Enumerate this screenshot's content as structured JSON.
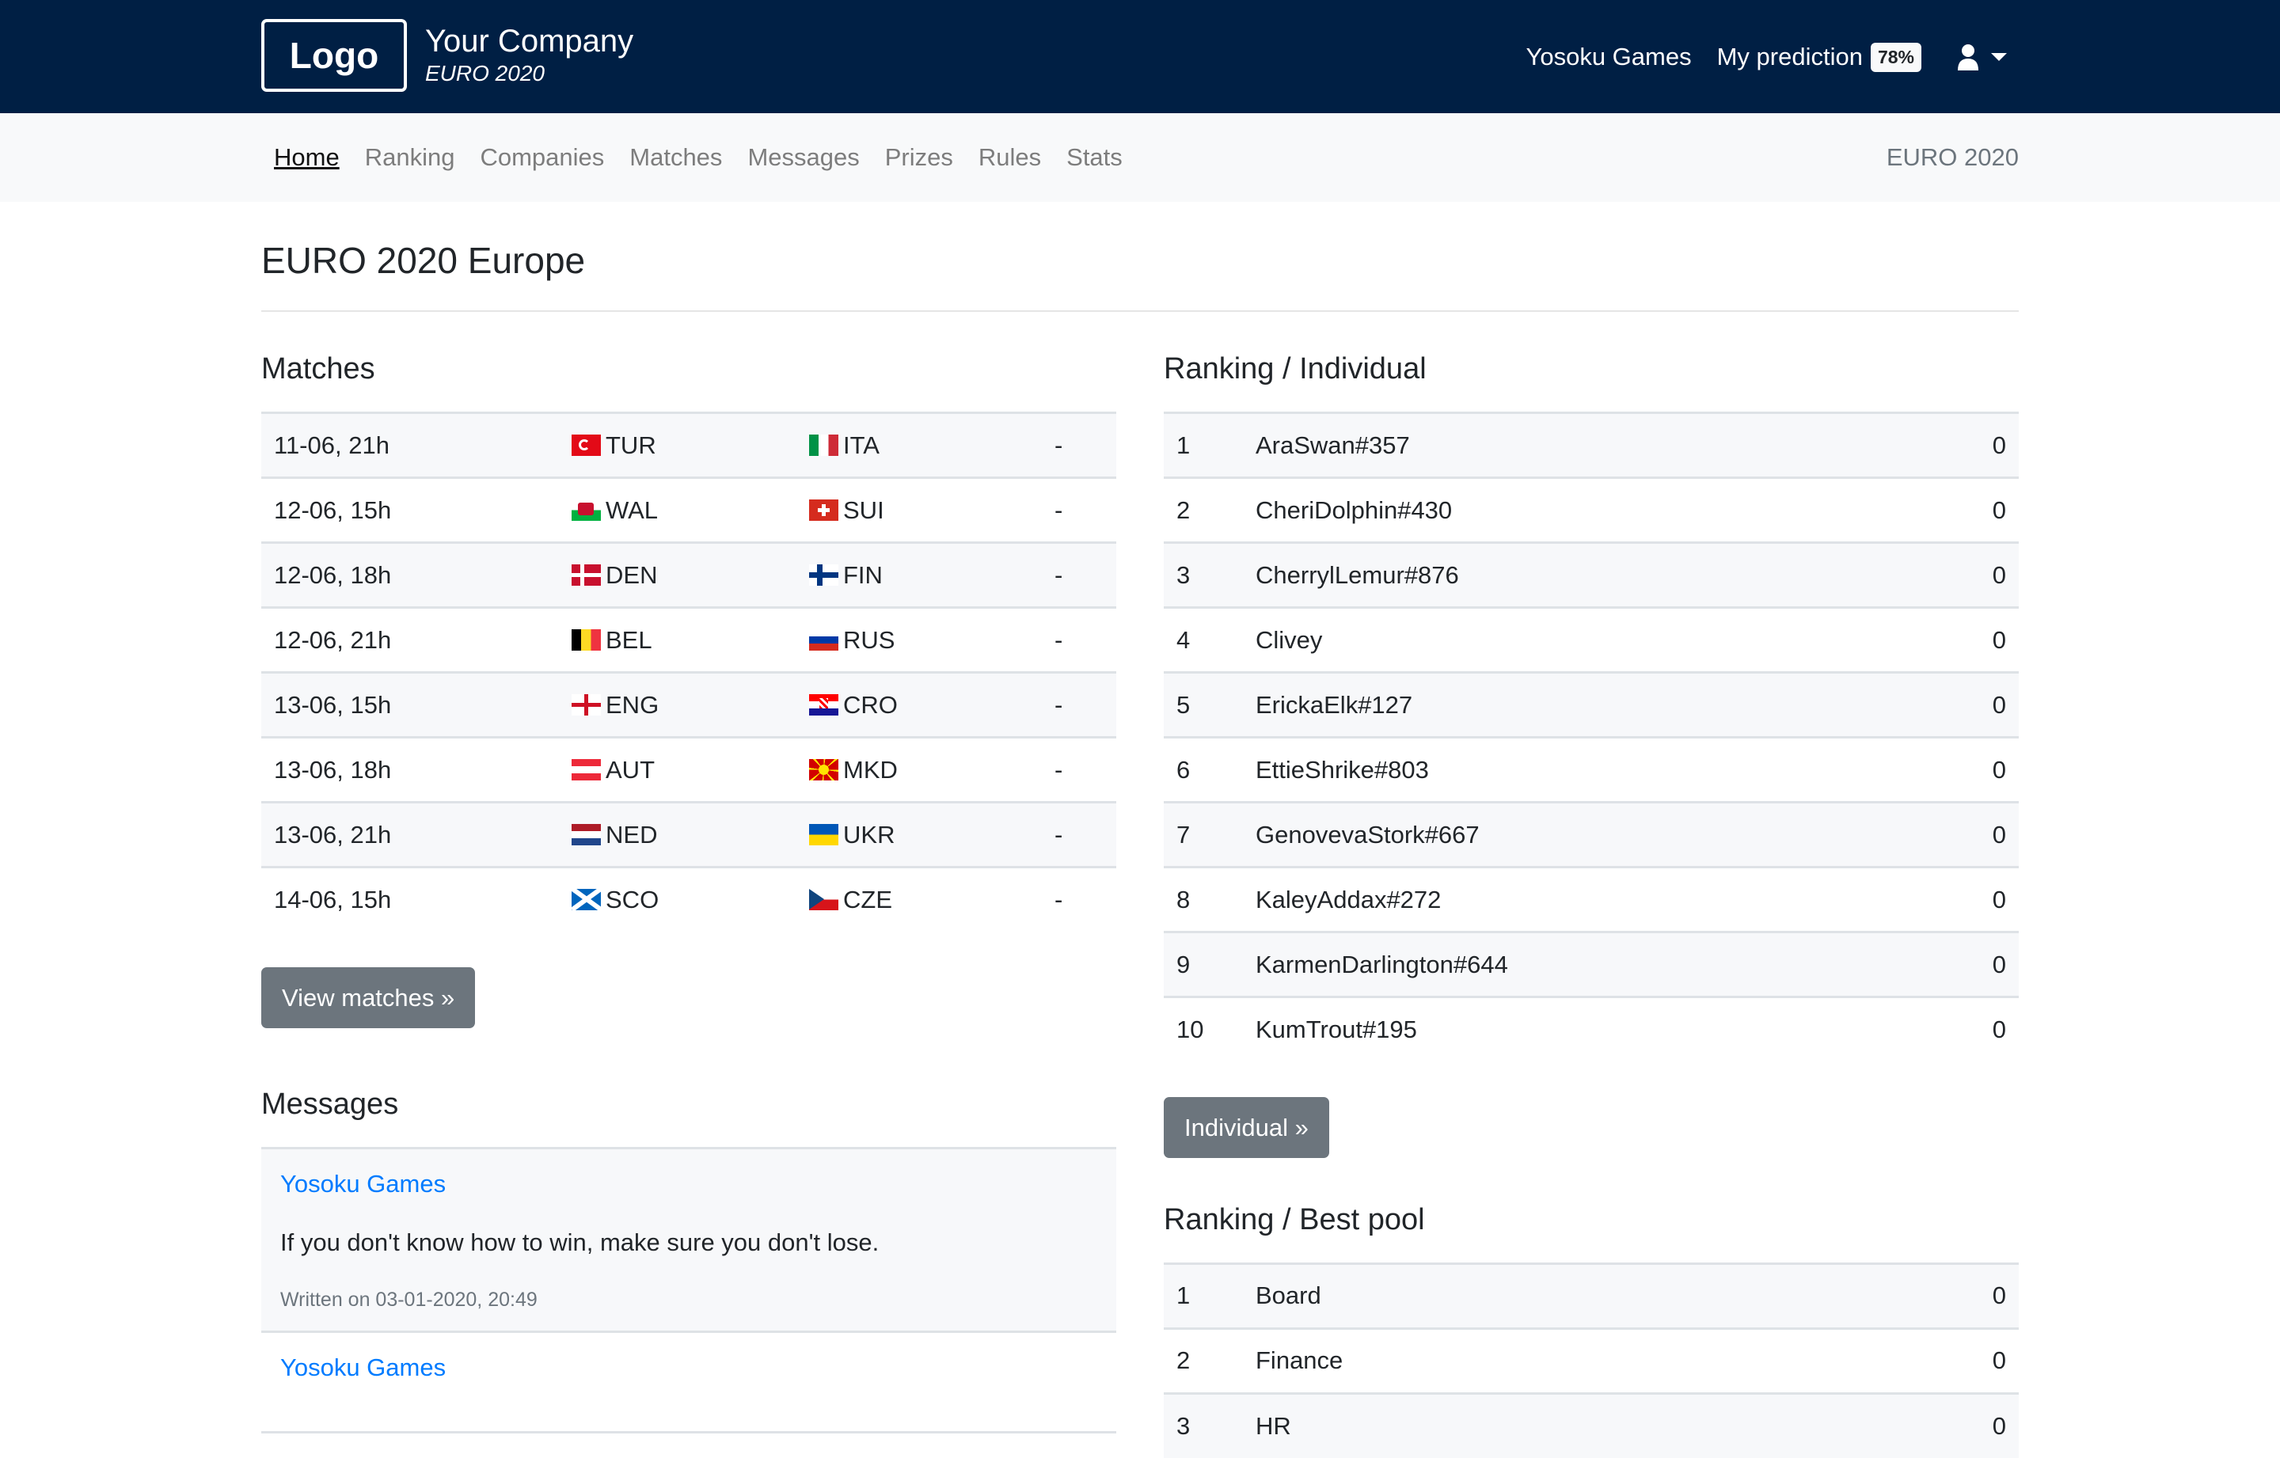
{
  "header": {
    "logo": "Logo",
    "company_name": "Your Company",
    "company_sub": "EURO 2020",
    "links": {
      "games": "Yosoku Games",
      "prediction": "My prediction"
    },
    "prediction_badge": "78%",
    "user_icon": "user-icon"
  },
  "subnav": {
    "items": [
      {
        "label": "Home",
        "active": true
      },
      {
        "label": "Ranking"
      },
      {
        "label": "Companies"
      },
      {
        "label": "Matches"
      },
      {
        "label": "Messages"
      },
      {
        "label": "Prizes"
      },
      {
        "label": "Rules"
      },
      {
        "label": "Stats"
      }
    ],
    "right_label": "EURO 2020"
  },
  "page": {
    "title": "EURO 2020 Europe"
  },
  "matches": {
    "heading": "Matches",
    "rows": [
      {
        "date": "11-06, 21h",
        "home": "TUR",
        "away": "ITA",
        "score": "-"
      },
      {
        "date": "12-06, 15h",
        "home": "WAL",
        "away": "SUI",
        "score": "-"
      },
      {
        "date": "12-06, 18h",
        "home": "DEN",
        "away": "FIN",
        "score": "-"
      },
      {
        "date": "12-06, 21h",
        "home": "BEL",
        "away": "RUS",
        "score": "-"
      },
      {
        "date": "13-06, 15h",
        "home": "ENG",
        "away": "CRO",
        "score": "-"
      },
      {
        "date": "13-06, 18h",
        "home": "AUT",
        "away": "MKD",
        "score": "-"
      },
      {
        "date": "13-06, 21h",
        "home": "NED",
        "away": "UKR",
        "score": "-"
      },
      {
        "date": "14-06, 15h",
        "home": "SCO",
        "away": "CZE",
        "score": "-"
      }
    ],
    "button": "View matches »"
  },
  "messages": {
    "heading": "Messages",
    "items": [
      {
        "author": "Yosoku Games",
        "body": "If you don't know how to win, make sure you don't lose.",
        "meta": "Written on 03-01-2020, 20:49"
      },
      {
        "author": "Yosoku Games"
      }
    ]
  },
  "ranking_individual": {
    "heading": "Ranking / Individual",
    "rows": [
      {
        "rank": "1",
        "name": "AraSwan#357",
        "score": "0"
      },
      {
        "rank": "2",
        "name": "CheriDolphin#430",
        "score": "0"
      },
      {
        "rank": "3",
        "name": "CherrylLemur#876",
        "score": "0"
      },
      {
        "rank": "4",
        "name": "Clivey",
        "score": "0"
      },
      {
        "rank": "5",
        "name": "ErickaElk#127",
        "score": "0"
      },
      {
        "rank": "6",
        "name": "EttieShrike#803",
        "score": "0"
      },
      {
        "rank": "7",
        "name": "GenovevaStork#667",
        "score": "0"
      },
      {
        "rank": "8",
        "name": "KaleyAddax#272",
        "score": "0"
      },
      {
        "rank": "9",
        "name": "KarmenDarlington#644",
        "score": "0"
      },
      {
        "rank": "10",
        "name": "KumTrout#195",
        "score": "0"
      }
    ],
    "button": "Individual »"
  },
  "ranking_pool": {
    "heading": "Ranking / Best pool",
    "rows": [
      {
        "rank": "1",
        "name": "Board",
        "score": "0"
      },
      {
        "rank": "2",
        "name": "Finance",
        "score": "0"
      },
      {
        "rank": "3",
        "name": "HR",
        "score": "0"
      }
    ]
  },
  "colors": {
    "header_bg": "#001f44",
    "subnav_bg": "#f8f9fa",
    "link": "#007bff",
    "button": "#6c757d"
  }
}
